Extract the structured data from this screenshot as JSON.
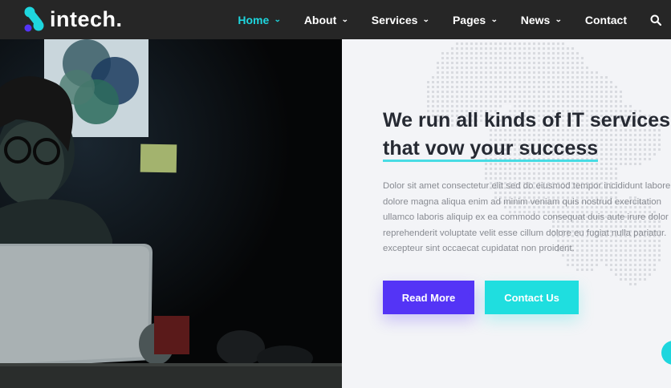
{
  "brand": {
    "name": "intech.",
    "accent": "#1ed6de",
    "primary": "#5434f6"
  },
  "nav": {
    "items": [
      {
        "label": "Home",
        "active": true,
        "has_dropdown": true
      },
      {
        "label": "About",
        "has_dropdown": true
      },
      {
        "label": "Services",
        "has_dropdown": true
      },
      {
        "label": "Pages",
        "has_dropdown": true
      },
      {
        "label": "News",
        "has_dropdown": true
      },
      {
        "label": "Contact",
        "has_dropdown": false
      }
    ],
    "search_icon": "search-icon"
  },
  "hero": {
    "headline_line1": "We run all kinds of IT services",
    "headline_line2": "that vow your success",
    "description_lines": [
      "Dolor sit amet consectetur elit sed do eiusmod tempor incididunt labore et",
      "dolore magna aliqua enim ad minim veniam quis nostrud exercitation",
      "ullamco laboris aliquip ex ea commodo consequat duis aute irure dolor in",
      "reprehenderit voluptate velit esse cillum dolore eu fugiat nulla pariatur.",
      "excepteur sint occaecat cupidatat non proident."
    ],
    "primary_button": "Read More",
    "secondary_button": "Contact Us"
  }
}
